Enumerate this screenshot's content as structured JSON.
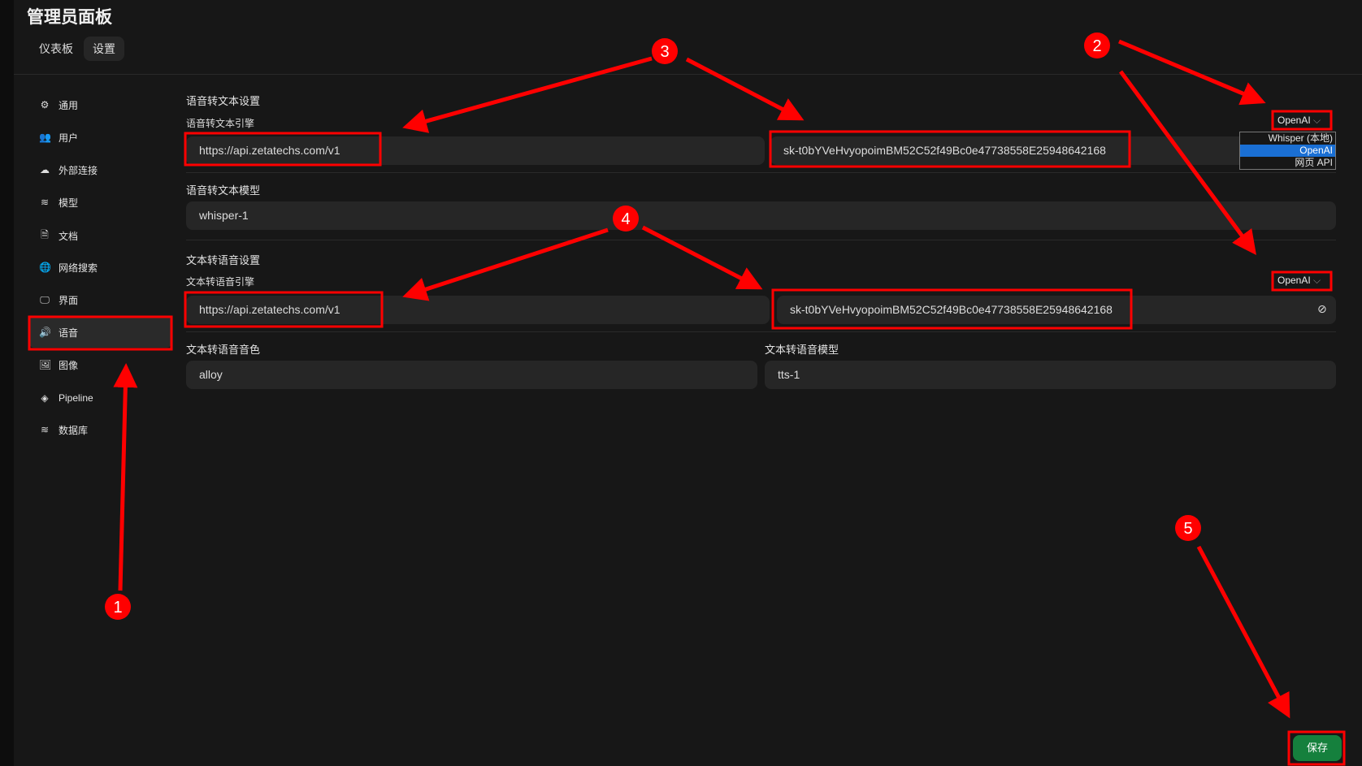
{
  "header": {
    "title": "管理员面板",
    "tabs": [
      "仪表板",
      "设置"
    ]
  },
  "sidebar": {
    "items": [
      {
        "label": "通用",
        "icon": "gear-icon",
        "glyph": "⚙"
      },
      {
        "label": "用户",
        "icon": "users-icon",
        "glyph": "👥"
      },
      {
        "label": "外部连接",
        "icon": "cloud-icon",
        "glyph": "☁"
      },
      {
        "label": "模型",
        "icon": "database-icon",
        "glyph": "≋"
      },
      {
        "label": "文档",
        "icon": "document-icon",
        "glyph": "🗎"
      },
      {
        "label": "网络搜索",
        "icon": "globe-icon",
        "glyph": "🌐"
      },
      {
        "label": "界面",
        "icon": "monitor-icon",
        "glyph": "🖵"
      },
      {
        "label": "语音",
        "icon": "speaker-icon",
        "glyph": "🔊"
      },
      {
        "label": "图像",
        "icon": "image-icon",
        "glyph": "🖼"
      },
      {
        "label": "Pipeline",
        "icon": "layers-icon",
        "glyph": "◈"
      },
      {
        "label": "数据库",
        "icon": "database-icon",
        "glyph": "≋"
      }
    ],
    "active": "语音"
  },
  "stt": {
    "heading": "语音转文本设置",
    "engine_label": "语音转文本引擎",
    "engine": "OpenAI",
    "engine_options": [
      "Whisper (本地)",
      "OpenAI",
      "网页 API"
    ],
    "url": "https://api.zetatechs.com/v1",
    "key": "sk-t0bYVeHvyopoimBM52C52f49Bc0e47738558E25948642168",
    "model_label": "语音转文本模型",
    "model": "whisper-1"
  },
  "tts": {
    "heading": "文本转语音设置",
    "engine_label": "文本转语音引擎",
    "engine": "OpenAI",
    "url": "https://api.zetatechs.com/v1",
    "key": "sk-t0bYVeHvyopoimBM52C52f49Bc0e47738558E25948642168",
    "voice_label": "文本转语音音色",
    "voice": "alloy",
    "model_label": "文本转语音模型",
    "model": "tts-1"
  },
  "save_label": "保存",
  "annotations": {
    "markers": [
      "1",
      "2",
      "3",
      "4",
      "5"
    ],
    "color": "#ff0000"
  }
}
